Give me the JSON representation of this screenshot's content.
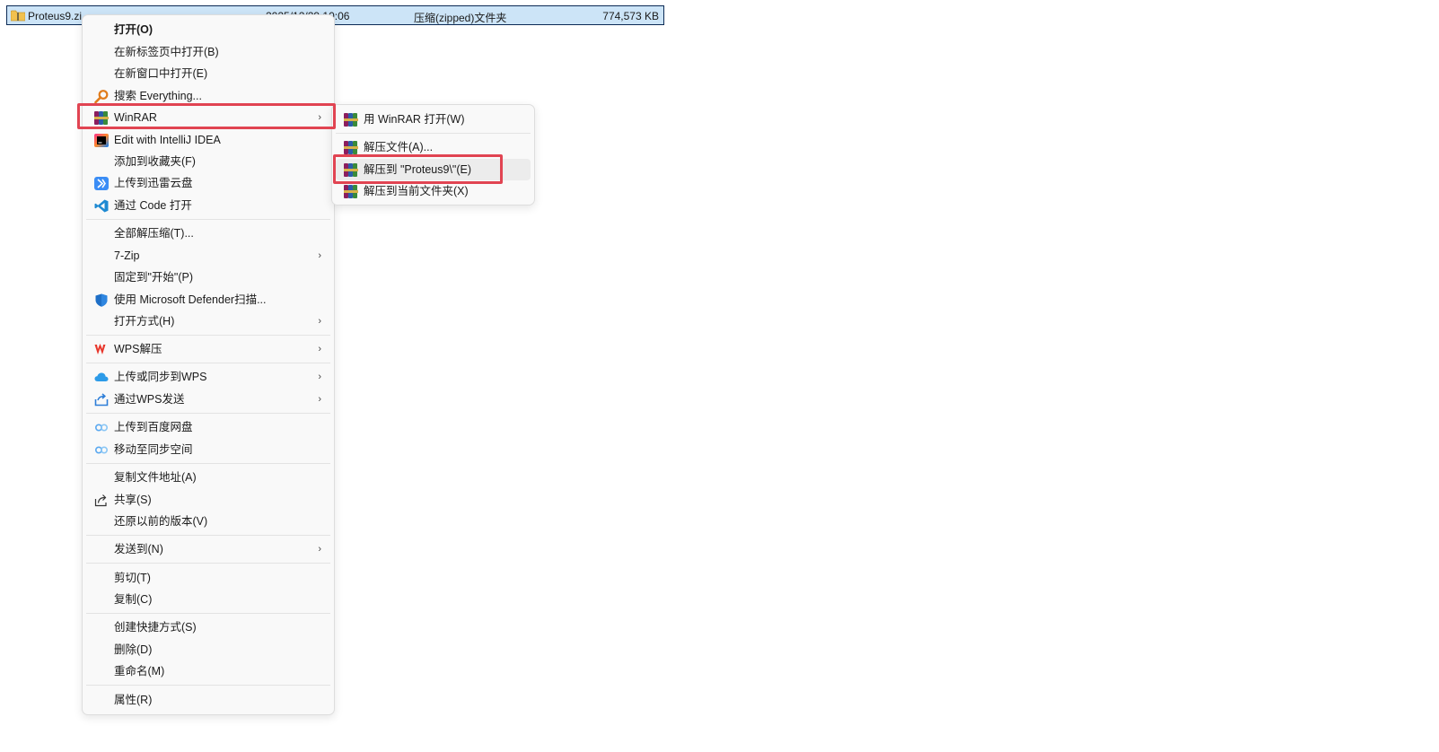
{
  "file": {
    "name": "Proteus9.zi",
    "date": "2025/12/29 10:06",
    "type": "压缩(zipped)文件夹",
    "size": "774,573 KB"
  },
  "menu": {
    "open": "打开(O)",
    "open_new_tab": "在新标签页中打开(B)",
    "open_new_window": "在新窗口中打开(E)",
    "search_everything": "搜索 Everything...",
    "winrar": "WinRAR",
    "edit_intellij": "Edit with IntelliJ IDEA",
    "add_favorites": "添加到收藏夹(F)",
    "upload_xunlei": "上传到迅雷云盘",
    "open_code": "通过 Code 打开",
    "extract_all": "全部解压缩(T)...",
    "seven_zip": "7-Zip",
    "pin_start": "固定到\"开始\"(P)",
    "defender": "使用 Microsoft Defender扫描...",
    "open_with": "打开方式(H)",
    "wps_extract": "WPS解压",
    "wps_upload_sync": "上传或同步到WPS",
    "wps_send": "通过WPS发送",
    "baidu_upload": "上传到百度网盘",
    "baidu_sync": "移动至同步空间",
    "copy_path": "复制文件地址(A)",
    "share": "共享(S)",
    "restore_versions": "还原以前的版本(V)",
    "send_to": "发送到(N)",
    "cut": "剪切(T)",
    "copy": "复制(C)",
    "create_shortcut": "创建快捷方式(S)",
    "delete": "删除(D)",
    "rename": "重命名(M)",
    "properties": "属性(R)"
  },
  "submenu": {
    "open_with_winrar": "用 WinRAR 打开(W)",
    "extract_files": "解压文件(A)...",
    "extract_to_folder": "解压到 \"Proteus9\\\"(E)",
    "extract_here": "解压到当前文件夹(X)"
  },
  "icons": {
    "folder": "zip-folder-icon",
    "search": "everything-search-icon",
    "winrar": "winrar-icon",
    "intellij": "intellij-icon",
    "xunlei": "xunlei-icon",
    "vscode": "vscode-icon",
    "defender": "defender-shield-icon",
    "wps": "wps-icon",
    "cloud": "wps-cloud-icon",
    "send": "wps-send-icon",
    "baidu": "baidu-netdisk-icon",
    "share": "share-icon"
  },
  "colors": {
    "highlight_box": "#e14452",
    "selection": "#cce4f7",
    "menu_bg": "#f9f9f9"
  }
}
